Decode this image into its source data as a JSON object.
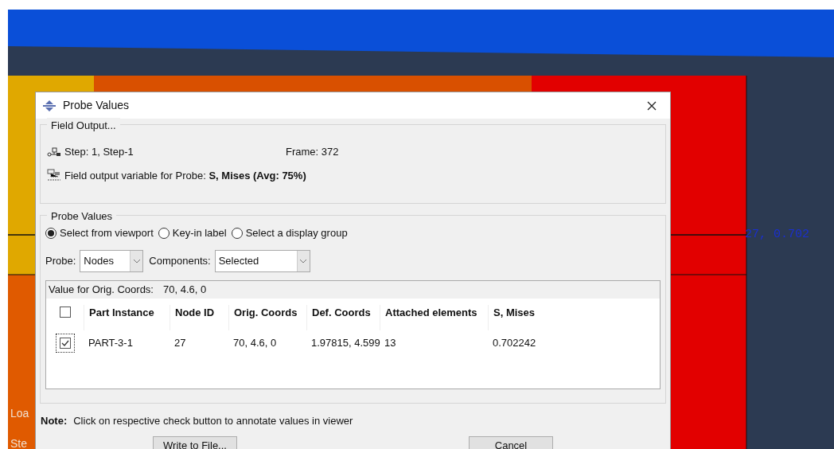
{
  "window": {
    "title": "Probe Values"
  },
  "field_output": {
    "title": "Field Output...",
    "step_label": "Step:",
    "step": "1, Step-1",
    "frame_label": "Frame:",
    "frame": "372",
    "variable_label": "Field output variable for Probe:",
    "variable": "S, Mises (Avg: 75%)"
  },
  "probe_values": {
    "title": "Probe Values",
    "radios": [
      {
        "label": "Select from viewport",
        "selected": true
      },
      {
        "label": "Key-in label",
        "selected": false
      },
      {
        "label": "Select a display group",
        "selected": false
      }
    ],
    "probe_label": "Probe:",
    "probe": "Nodes",
    "components_label": "Components:",
    "components": "Selected"
  },
  "table": {
    "caption_label": "Value for Orig. Coords:",
    "caption_value": "70, 4.6, 0",
    "header_checked": false,
    "columns": [
      "Part Instance",
      "Node ID",
      "Orig. Coords",
      "Def. Coords",
      "Attached elements",
      "S, Mises"
    ],
    "rows": [
      {
        "checked": true,
        "cells": [
          "PART-3-1",
          "27",
          "70, 4.6, 0",
          "1.97815, 4.599",
          "13",
          "0.702242"
        ]
      }
    ]
  },
  "note": {
    "label": "Note:",
    "text": "Click on respective check button to annotate values in viewer"
  },
  "buttons": [
    "Write to File...",
    "Cancel"
  ],
  "viewport": {
    "annotation": "27, 0.702",
    "legend_texts": [
      "Loa",
      "Ste"
    ]
  }
}
